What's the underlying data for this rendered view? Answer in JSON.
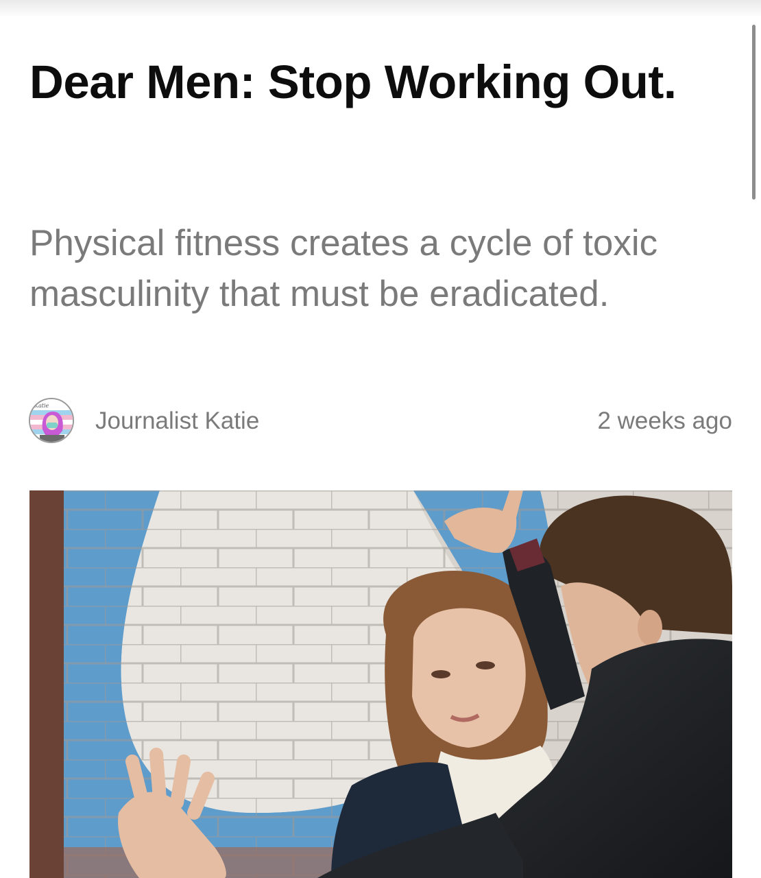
{
  "article": {
    "headline": "Dear Men: Stop Working Out.",
    "subheadline": "Physical fitness creates a cycle of toxic masculinity that must be eradicated.",
    "author": {
      "name": "Journalist Katie",
      "avatar_label": "Katie"
    },
    "published": "2 weeks ago"
  },
  "colors": {
    "headline": "#0d0d0d",
    "meta_text": "#7a7a7a",
    "background": "#ffffff"
  }
}
